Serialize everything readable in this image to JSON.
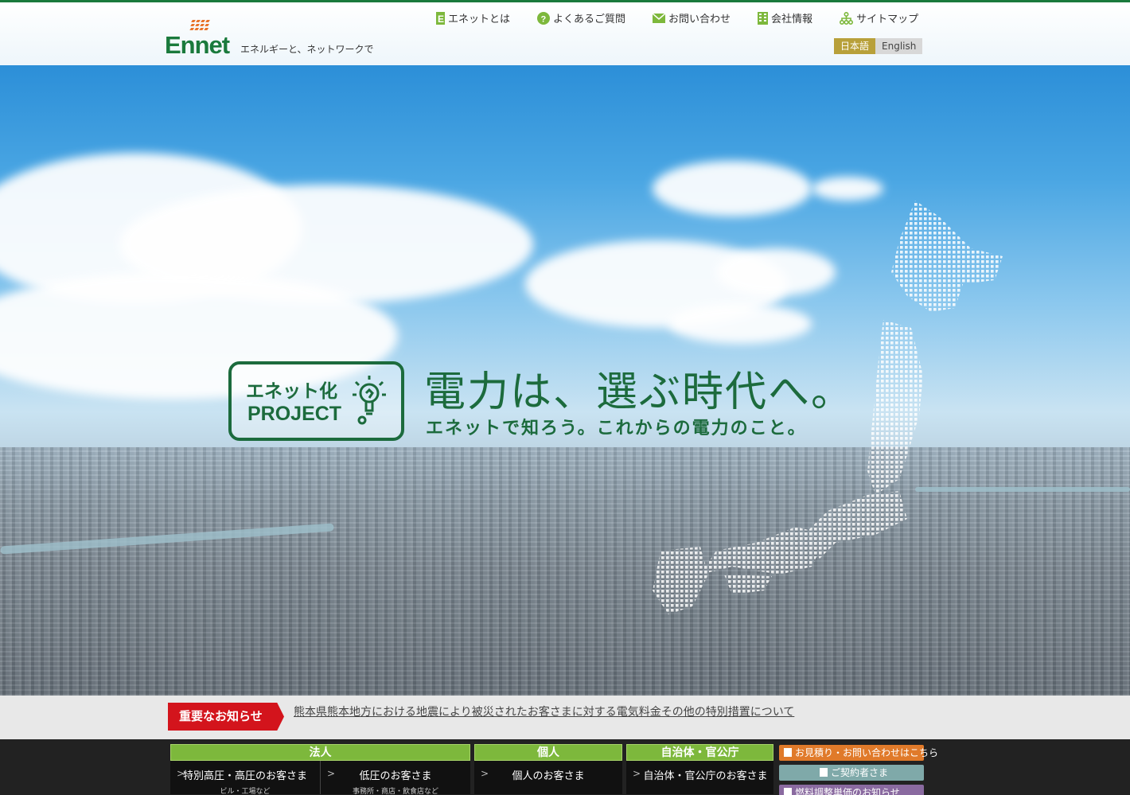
{
  "header": {
    "logo_text": "Ennet",
    "tagline": "エネルギーと、ネットワークで",
    "nav": [
      {
        "label": "エネットとは",
        "icon": "e-logo-icon"
      },
      {
        "label": "よくあるご質問",
        "icon": "question-icon"
      },
      {
        "label": "お問い合わせ",
        "icon": "mail-icon"
      },
      {
        "label": "会社情報",
        "icon": "building-icon"
      },
      {
        "label": "サイトマップ",
        "icon": "sitemap-icon"
      }
    ],
    "lang_ja": "日本語",
    "lang_en": "English"
  },
  "hero": {
    "badge_line1": "エネット化",
    "badge_line2": "PROJECT",
    "headline": "電力は、選ぶ時代へ。",
    "subline": "エネットで知ろう。これからの電力のこと。"
  },
  "notice": {
    "label": "重要なお知らせ",
    "link": "熊本県熊本地方における地震により被災されたお客さまに対する電気料金その他の特別措置について"
  },
  "categories": {
    "corporate": {
      "head": "法人",
      "items": [
        {
          "label": "特別高圧・高圧のお客さま",
          "sub": "ビル・工場など"
        },
        {
          "label": "低圧のお客さま",
          "sub": "事務所・商店・飲食店など"
        }
      ]
    },
    "personal": {
      "head": "個人",
      "items": [
        {
          "label": "個人のお客さま"
        }
      ]
    },
    "government": {
      "head": "自治体・官公庁",
      "items": [
        {
          "label": "自治体・官公庁のお客さま"
        }
      ]
    }
  },
  "side_buttons": {
    "estimate": "お見積り・お問い合わせはこちら",
    "contractor": "ご契約者さま",
    "fuel": "燃料調整単価のお知らせ"
  },
  "colors": {
    "brand_green": "#1a7a3c",
    "notice_red": "#d3141c",
    "category_green": "#7db83c"
  }
}
